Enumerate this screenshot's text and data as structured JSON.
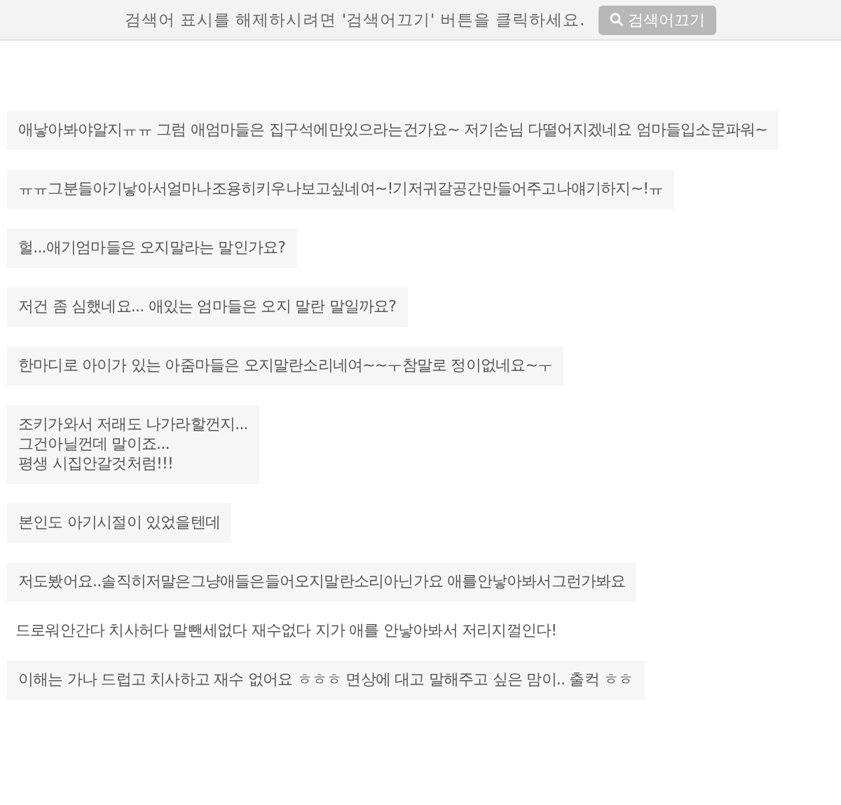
{
  "notice": {
    "text": "검색어 표시를 해제하시려면 '검색어끄기' 버튼을 클릭하세요.",
    "button": "검색어끄기"
  },
  "comments": [
    {
      "kind": "box",
      "text": "애낳아봐야알지ㅠㅠ 그럼 애엄마들은 집구석에만있으라는건가요~ 저기손님 다떨어지겠네요 엄마들입소문파워~"
    },
    {
      "kind": "box",
      "text": "ㅠㅠ그분들아기낳아서얼마나조용히키우나보고싶네여~!기저귀갈공간만들어주고나얘기하지~!ㅠ"
    },
    {
      "kind": "box",
      "text": "헐...애기엄마들은 오지말라는 말인가요?"
    },
    {
      "kind": "box",
      "text": "저건 좀 심했네요... 애있는 엄마들은 오지 말란 말일까요?"
    },
    {
      "kind": "box",
      "text": "한마디로 아이가 있는 아줌마들은 오지말란소리네여~~ㅜ참말로 정이없네요~ㅜ"
    },
    {
      "kind": "box",
      "text": "조키가와서 저래도 나가라할껀지...\n그건아닐껀데 말이죠...\n평생 시집안갈것처럼!!!"
    },
    {
      "kind": "box",
      "text": "본인도 아기시절이 있었을텐데"
    },
    {
      "kind": "box",
      "text": "저도봤어요..솔직히저말은그냥애들은들어오지말란소리아닌가요 애를안낳아봐서그런가봐요"
    },
    {
      "kind": "plain",
      "text": "드로워안간다 치사허다 말뺀세없다 재수없다 지가 애를 안낳아봐서 저리지껄인다!"
    },
    {
      "kind": "box",
      "text": "이해는 가나 드럽고 치사하고 재수 없어요 ㅎㅎㅎ 면상에 대고 말해주고 싶은 맘이.. 출컥 ㅎㅎ"
    }
  ]
}
